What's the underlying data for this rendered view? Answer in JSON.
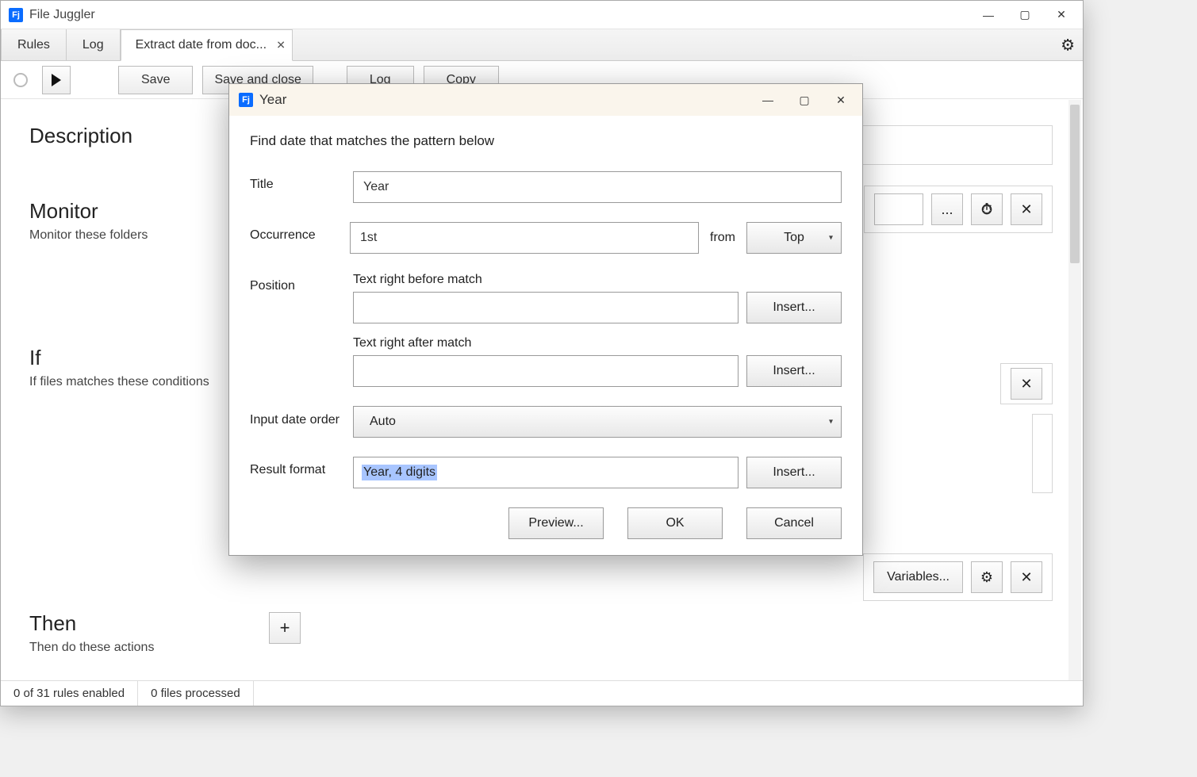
{
  "app": {
    "title": "File Juggler",
    "icon_text": "Fj"
  },
  "window_controls": {
    "min": "—",
    "max": "▢",
    "close": "✕"
  },
  "tabs": {
    "rules": "Rules",
    "log": "Log",
    "active": "Extract date from doc..."
  },
  "toolbar": {
    "save": "Save",
    "save_close": "Save and close",
    "log": "Log",
    "copy": "Copy"
  },
  "sections": {
    "description": "Description",
    "monitor_title": "Monitor",
    "monitor_sub": "Monitor these folders",
    "if_title": "If",
    "if_sub": "If files matches these conditions",
    "then_title": "Then",
    "then_sub": "Then do these actions"
  },
  "right_panel": {
    "browse": "...",
    "variables": "Variables..."
  },
  "statusbar": {
    "rules": "0 of 31 rules enabled",
    "files": "0 files processed"
  },
  "dialog": {
    "title": "Year",
    "instruction": "Find date that matches the pattern below",
    "labels": {
      "title": "Title",
      "occurrence": "Occurrence",
      "from": "from",
      "position": "Position",
      "before": "Text right before match",
      "after": "Text right after match",
      "input_date_order": "Input date order",
      "result_format": "Result format"
    },
    "values": {
      "title": "Year",
      "occurrence": "1st",
      "from_dropdown": "Top",
      "before": "",
      "after": "",
      "input_date_order": "Auto",
      "result_format": "Year, 4 digits"
    },
    "buttons": {
      "insert": "Insert...",
      "preview": "Preview...",
      "ok": "OK",
      "cancel": "Cancel"
    }
  }
}
